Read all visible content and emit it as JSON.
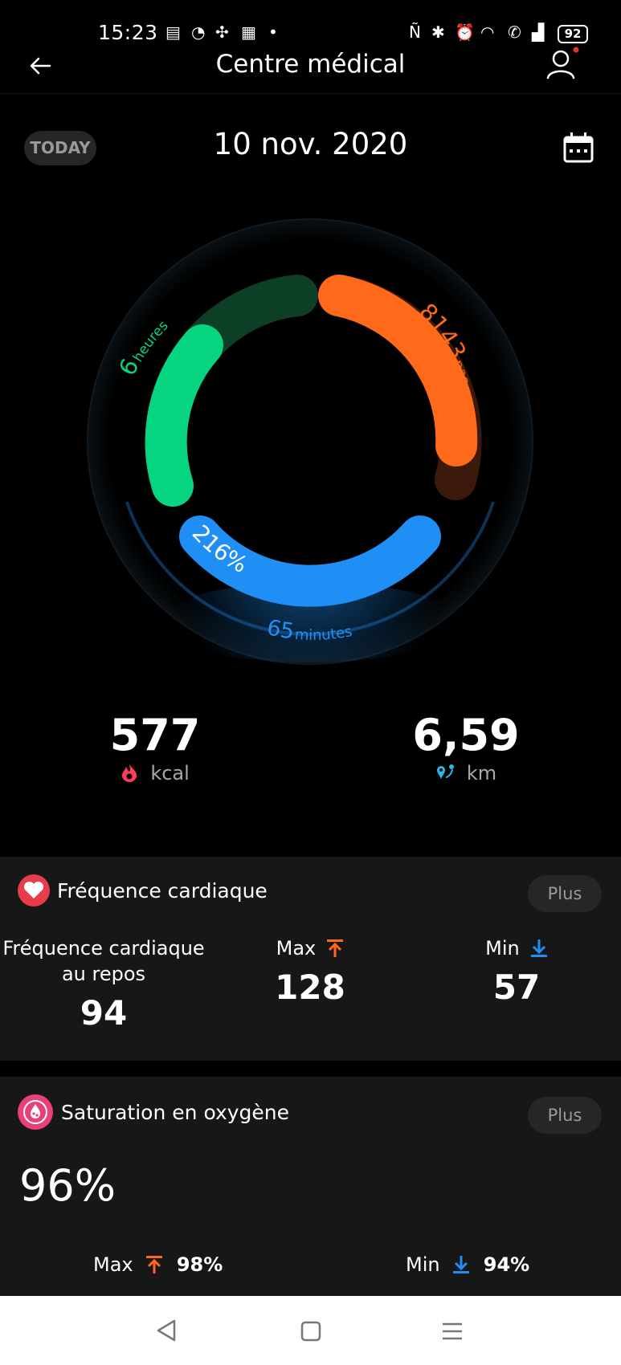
{
  "status_bar": {
    "time": "15:23",
    "battery": "92"
  },
  "header": {
    "title": "Centre médical"
  },
  "date_row": {
    "today_label": "TODAY",
    "date": "10 nov. 2020"
  },
  "ring": {
    "hours_value": "6",
    "hours_unit": "heures",
    "steps_value": "8143",
    "steps_unit": "pas",
    "percent": "216%",
    "minutes_value": "65",
    "minutes_unit": "minutes",
    "colors": {
      "green": "#06d47f",
      "orange": "#ff6a1a",
      "blue": "#1f8ff5"
    }
  },
  "stats": {
    "calories": {
      "value": "577",
      "unit": "kcal",
      "icon": "flame-icon"
    },
    "distance": {
      "value": "6,59",
      "unit": "km",
      "icon": "route-pin-icon"
    }
  },
  "heart_rate": {
    "title": "Fréquence cardiaque",
    "more": "Plus",
    "resting_label_line1": "Fréquence cardiaque",
    "resting_label_line2": "au repos",
    "resting_value": "94",
    "max_label": "Max",
    "max_value": "128",
    "min_label": "Min",
    "min_value": "57"
  },
  "oxygen": {
    "title": "Saturation en oxygène",
    "more": "Plus",
    "value": "96%",
    "max_label": "Max",
    "max_value": "98%",
    "min_label": "Min",
    "min_value": "94%"
  }
}
